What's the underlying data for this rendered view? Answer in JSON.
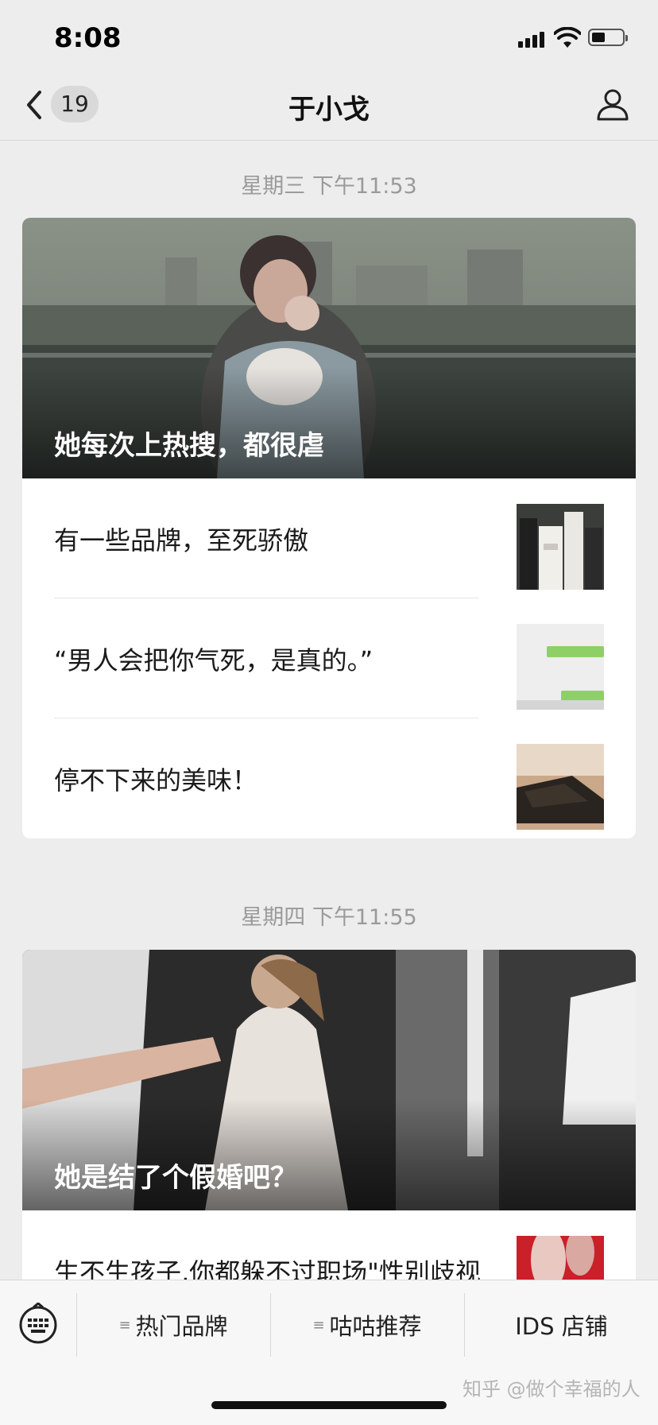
{
  "status_bar": {
    "time": "8:08",
    "battery_level": 0.45
  },
  "nav": {
    "back_count": "19",
    "title": "于小戈"
  },
  "groups": [
    {
      "timestamp": "星期三 下午11:53",
      "headline": "她每次上热搜，都很虐",
      "items": [
        {
          "title": "有一些品牌，至死骄傲",
          "thumb": "cosmetics-bottles"
        },
        {
          "title": "“男人会把你气死，是真的。”",
          "thumb": "chat-screenshot"
        },
        {
          "title": "停不下来的美味！",
          "thumb": "snack-food"
        }
      ]
    },
    {
      "timestamp": "星期四 下午11:55",
      "headline": "她是结了个假婚吧？",
      "items": [
        {
          "title": "生不生孩子,你都躲不过职场\"性别歧视",
          "thumb": "red-image"
        }
      ]
    }
  ],
  "bottom_menu": {
    "keyboard_icon": "keyboard-icon",
    "items": [
      "热门品牌",
      "咕咕推荐",
      "IDS 店铺"
    ]
  },
  "watermark": "知乎 @做个幸福的人"
}
